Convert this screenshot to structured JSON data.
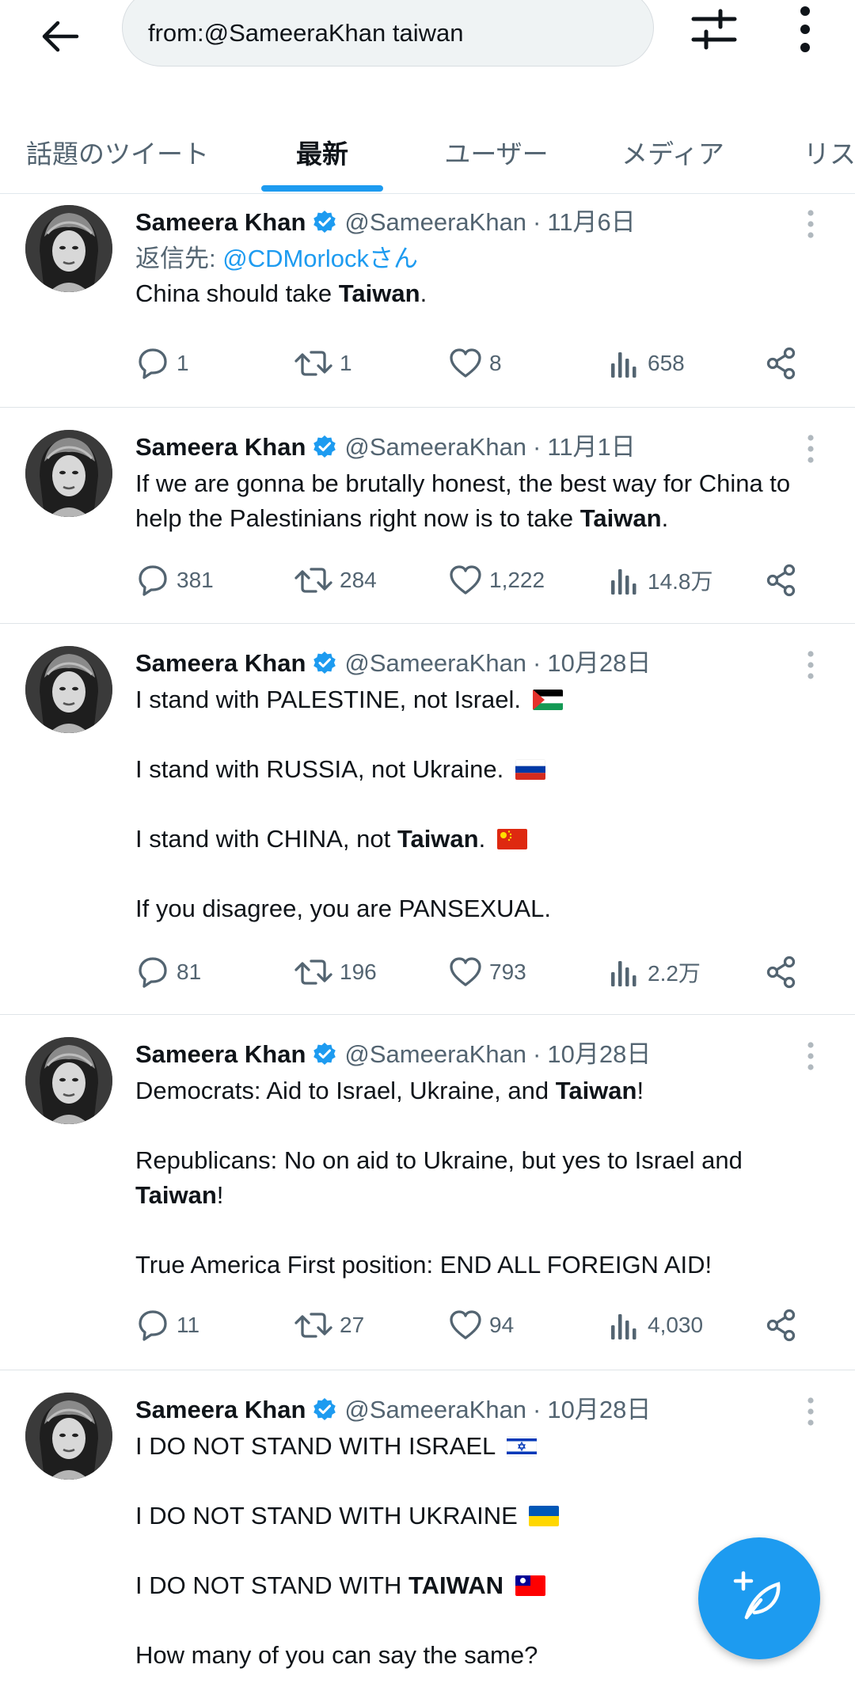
{
  "search": {
    "query": "from:@SameeraKhan taiwan"
  },
  "tabs": [
    "話題のツイート",
    "最新",
    "ユーザー",
    "メディア",
    "リス"
  ],
  "active_tab": "最新",
  "accent_color": "#1d9bf0",
  "author": {
    "name": "Sameera Khan",
    "handle": "@SameeraKhan"
  },
  "tweets": [
    {
      "time": "11月6日",
      "reply_prefix": "返信先: ",
      "reply_to": "@CDMorlockさん",
      "lines": [
        {
          "a": "China should take ",
          "b": "Taiwan",
          "c": "."
        }
      ],
      "stats": {
        "replies": "1",
        "retweets": "1",
        "likes": "8",
        "views": "658"
      }
    },
    {
      "time": "11月1日",
      "lines": [
        {
          "a": "If we are gonna be brutally honest, the best way for China to help the Palestinians right now is to take ",
          "b": "Taiwan",
          "c": "."
        }
      ],
      "stats": {
        "replies": "381",
        "retweets": "284",
        "likes": "1,222",
        "views": "14.8万"
      }
    },
    {
      "time": "10月28日",
      "lines": [
        {
          "a": "I stand with PALESTINE, not Israel.",
          "b": "",
          "c": ""
        },
        {
          "a": "I stand with RUSSIA, not Ukraine.",
          "b": "",
          "c": ""
        },
        {
          "a": "I stand with CHINA, not ",
          "b": "Taiwan",
          "c": "."
        },
        {
          "a": "If you disagree, you are PANSEXUAL.",
          "b": "",
          "c": ""
        }
      ],
      "flags": [
        "palestine",
        "russia",
        "china"
      ],
      "stats": {
        "replies": "81",
        "retweets": "196",
        "likes": "793",
        "views": "2.2万"
      }
    },
    {
      "time": "10月28日",
      "lines": [
        {
          "a": "Democrats: Aid to Israel, Ukraine, and ",
          "b": "Taiwan",
          "c": "!"
        },
        {
          "a": "Republicans: No on aid to Ukraine, but yes to Israel and ",
          "b": "Taiwan",
          "c": "!"
        },
        {
          "a": "True America First position: END ALL FOREIGN AID!",
          "b": "",
          "c": ""
        }
      ],
      "stats": {
        "replies": "11",
        "retweets": "27",
        "likes": "94",
        "views": "4,030"
      }
    },
    {
      "time": "10月28日",
      "lines": [
        {
          "a": "I DO NOT STAND WITH ISRAEL",
          "b": "",
          "c": ""
        },
        {
          "a": "I DO NOT STAND WITH UKRAINE",
          "b": "",
          "c": ""
        },
        {
          "a": "I DO NOT STAND WITH ",
          "b": "TAIWAN",
          "c": ""
        },
        {
          "a": "How many of you can say the same?",
          "b": "",
          "c": ""
        }
      ],
      "flags": [
        "israel",
        "ukraine",
        "taiwan"
      ]
    }
  ],
  "icons": [
    "back-arrow-icon",
    "tune-icon",
    "more-vertical-icon",
    "verified-badge-icon",
    "reply-icon",
    "retweet-icon",
    "like-icon",
    "views-icon",
    "share-icon",
    "compose-icon"
  ]
}
